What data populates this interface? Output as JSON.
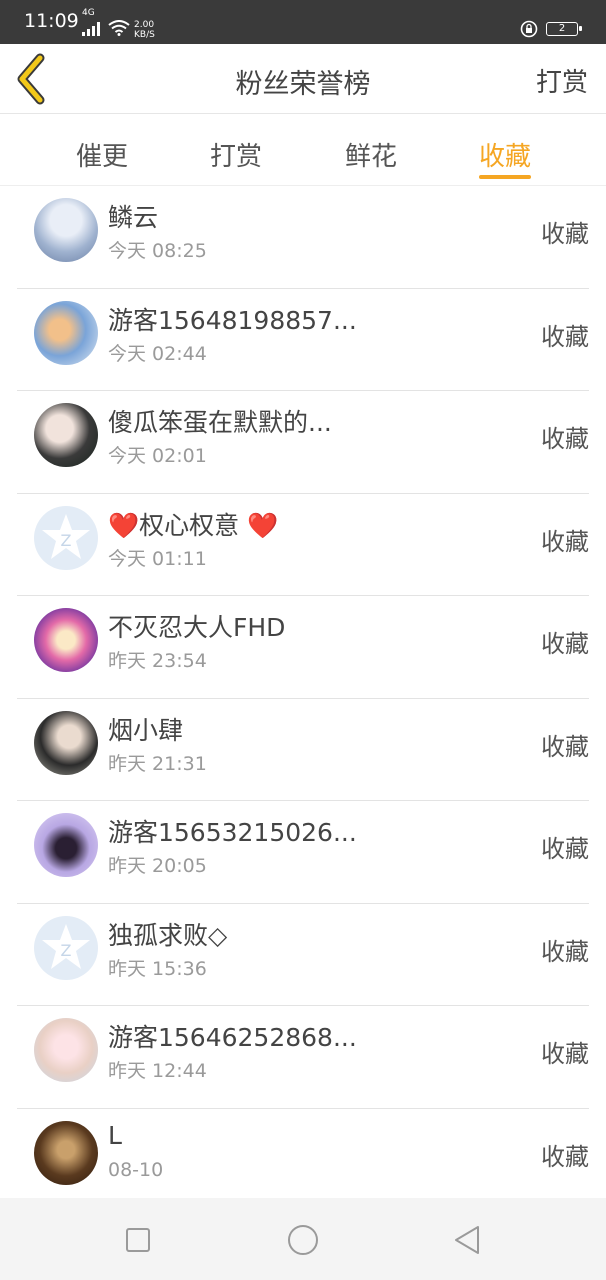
{
  "status_bar": {
    "time": "11:09",
    "net_type": "4G",
    "net_speed_value": "2.00",
    "net_speed_unit": "KB/S",
    "battery_level": "2"
  },
  "header": {
    "title": "粉丝荣誉榜",
    "action": "打赏"
  },
  "tabs": [
    {
      "label": "催更",
      "active": false
    },
    {
      "label": "打赏",
      "active": false
    },
    {
      "label": "鲜花",
      "active": false
    },
    {
      "label": "收藏",
      "active": true
    }
  ],
  "accent_color": "#f5a623",
  "fans": [
    {
      "name": "鳞云",
      "time": "今天 08:25",
      "action": "收藏"
    },
    {
      "name": "游客15648198857...",
      "time": "今天 02:44",
      "action": "收藏"
    },
    {
      "name": "傻瓜笨蛋在默默的...",
      "time": "今天 02:01",
      "action": "收藏"
    },
    {
      "name": "❤️权心权意 ❤️",
      "time": "今天 01:11",
      "action": "收藏"
    },
    {
      "name": "不灭忍大人FHD",
      "time": "昨天 23:54",
      "action": "收藏"
    },
    {
      "name": "烟小肆",
      "time": "昨天 21:31",
      "action": "收藏"
    },
    {
      "name": "游客15653215026...",
      "time": "昨天 20:05",
      "action": "收藏"
    },
    {
      "name": "独孤求败◇",
      "time": "昨天 15:36",
      "action": "收藏"
    },
    {
      "name": "游客15646252868...",
      "time": "昨天 12:44",
      "action": "收藏"
    },
    {
      "name": "L",
      "time": "08-10",
      "action": "收藏"
    }
  ],
  "icons": {
    "back": "chevron-left-icon",
    "nav_recent": "square-icon",
    "nav_home": "circle-icon",
    "nav_back": "triangle-back-icon"
  }
}
